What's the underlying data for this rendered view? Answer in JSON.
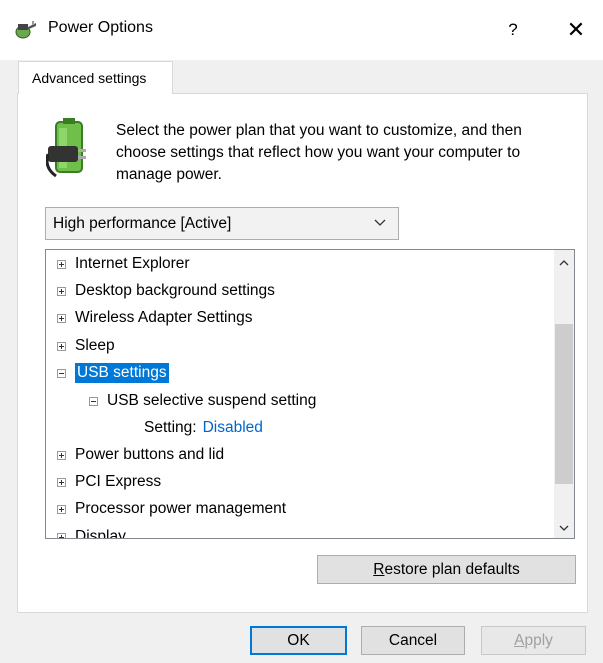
{
  "window": {
    "title": "Power Options",
    "help_label": "?",
    "close_label": "✕"
  },
  "tab": {
    "label": "Advanced settings"
  },
  "intro_text": "Select the power plan that you want to customize, and then choose settings that reflect how you want your computer to manage power.",
  "plan_select": {
    "value": "High performance [Active]"
  },
  "tree": {
    "items": [
      {
        "label": "Internet Explorer",
        "state": "collapsed"
      },
      {
        "label": "Desktop background settings",
        "state": "collapsed"
      },
      {
        "label": "Wireless Adapter Settings",
        "state": "collapsed"
      },
      {
        "label": "Sleep",
        "state": "collapsed"
      },
      {
        "label": "USB settings",
        "state": "expanded",
        "selected": true
      },
      {
        "label": "USB selective suspend setting",
        "state": "expanded"
      },
      {
        "label": "Setting:",
        "value": "Disabled"
      },
      {
        "label": "Power buttons and lid",
        "state": "collapsed"
      },
      {
        "label": "PCI Express",
        "state": "collapsed"
      },
      {
        "label": "Processor power management",
        "state": "collapsed"
      },
      {
        "label": "Display",
        "state": "collapsed"
      }
    ]
  },
  "buttons": {
    "restore_first": "R",
    "restore_rest": "estore plan defaults",
    "ok": "OK",
    "cancel": "Cancel",
    "apply_first": "A",
    "apply_rest": "pply"
  },
  "colors": {
    "selection": "#0078d7",
    "link": "#0066cc",
    "ok_border": "#0078d7"
  }
}
